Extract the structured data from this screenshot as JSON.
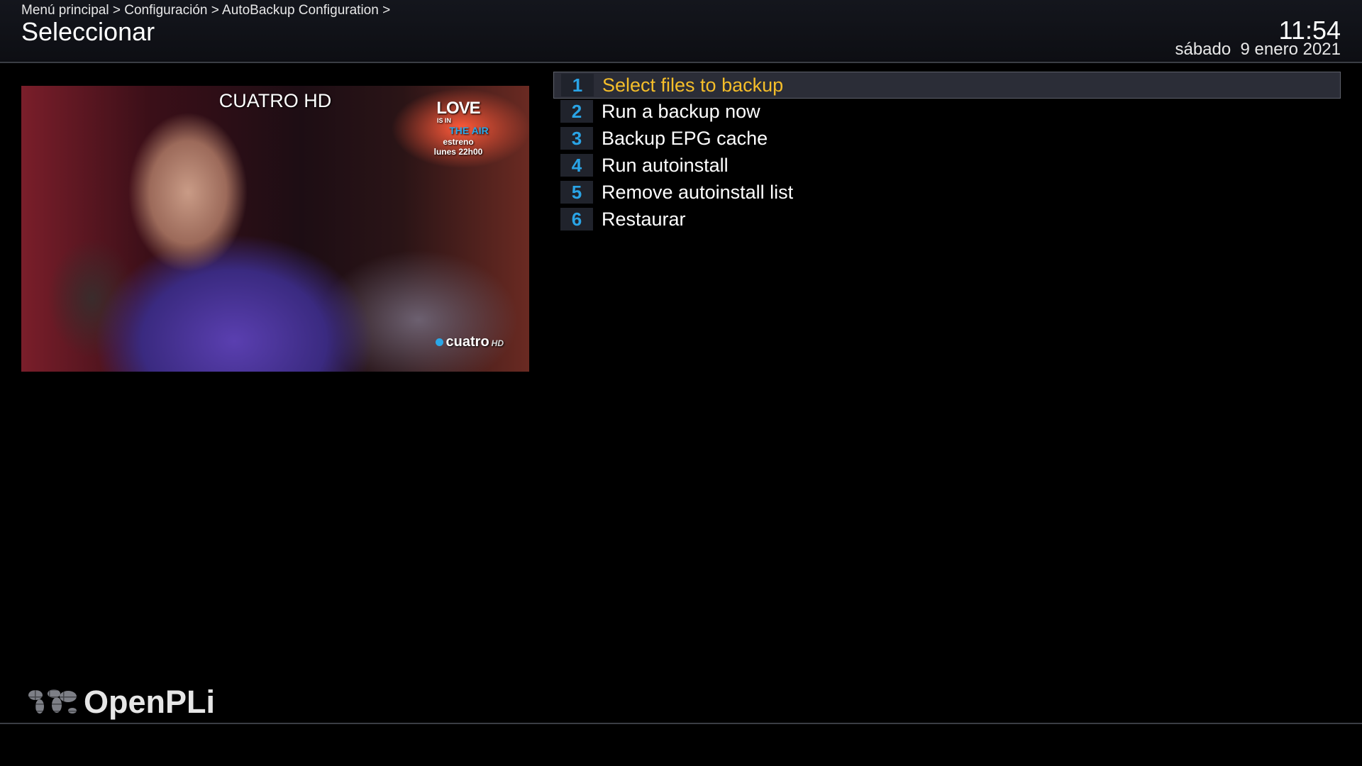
{
  "header": {
    "breadcrumb": "Menú principal > Configuración > AutoBackup Configuration >",
    "title": "Seleccionar",
    "time": "11:54",
    "date": "sábado  9 enero 2021"
  },
  "tv": {
    "channel_name": "CUATRO HD",
    "promo": {
      "love": "LOVE",
      "is_in": "IS IN",
      "the_air": "THE AIR",
      "line1": "estreno",
      "line2": "lunes 22h00"
    },
    "logo": "cuatro",
    "logo_hd": "HD"
  },
  "menu": {
    "items": [
      {
        "number": "1",
        "label": "Select files to backup",
        "selected": true
      },
      {
        "number": "2",
        "label": "Run a backup now"
      },
      {
        "number": "3",
        "label": "Backup EPG cache"
      },
      {
        "number": "4",
        "label": "Run autoinstall"
      },
      {
        "number": "5",
        "label": "Remove autoinstall list"
      },
      {
        "number": "6",
        "label": "Restaurar"
      }
    ]
  },
  "footer": {
    "brand": "OpenPLi",
    "brand_icon": "world-map-icon"
  },
  "colors": {
    "selected_text": "#f5be2a",
    "number_text": "#2aa4e6",
    "selected_bg": "#2b2d37"
  }
}
